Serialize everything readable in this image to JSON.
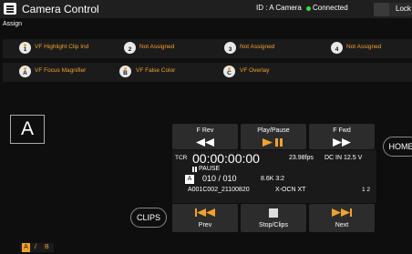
{
  "header": {
    "title": "Camera Control",
    "camera_id": "ID : A Camera",
    "connection": "Connected",
    "lock_label": "Lock"
  },
  "colors": {
    "accent": "#f2a12f",
    "connected": "#3cdc46"
  },
  "assign": {
    "title": "Assign",
    "row1": [
      {
        "badge": "1",
        "label": "VF Highlight Clip Ind",
        "dot": "#f2a12f"
      },
      {
        "badge": "2",
        "label": "Not Assigned"
      },
      {
        "badge": "3",
        "label": "Not Assigned"
      },
      {
        "badge": "4",
        "label": "Not Assigned"
      }
    ],
    "row2": [
      {
        "badge": "A",
        "label": "VF Focus Magnifier",
        "dot": "#f2a12f"
      },
      {
        "badge": "B",
        "label": "VF False Color",
        "dot": "#f2a12f"
      },
      {
        "badge": "C",
        "label": "VF Overlay",
        "dot": "#f2a12f"
      }
    ]
  },
  "camera_letter": "A",
  "transport": {
    "f_rev": "F Rev",
    "play_pause": "Play/Pause",
    "f_fwd": "F Fwd",
    "prev": "Prev",
    "stop_clips": "Stop/Clips",
    "next": "Next"
  },
  "buttons": {
    "home": "HOME",
    "clips": "CLIPS"
  },
  "status": {
    "tcr_label": "TCR",
    "timecode": "00:00:00:00",
    "fps": "23.98fps",
    "dc_in": "DC IN 12.5 V",
    "state": "PAUSE",
    "slot": "A",
    "clip_count": "010 / 010",
    "format": "8.6K 3:2",
    "clip_name": "A001C002_21100820",
    "codec": "X-OCN XT",
    "page": "1 2"
  },
  "ab_toggle": {
    "a": "A",
    "sep": "/",
    "b": "B"
  }
}
